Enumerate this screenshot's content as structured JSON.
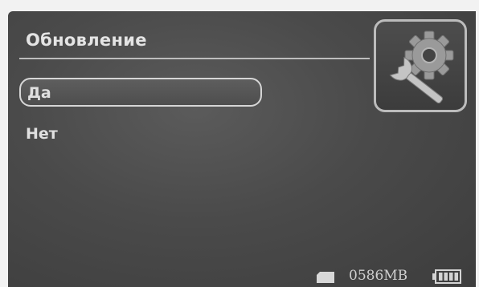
{
  "screen": {
    "title": "Обновление"
  },
  "menu": {
    "items": [
      {
        "label": "Да",
        "selected": true
      },
      {
        "label": "Нет",
        "selected": false
      }
    ]
  },
  "icons": {
    "settings": "gear-and-wrench-icon",
    "storage": "sd-card-icon",
    "battery": "battery-icon"
  },
  "status": {
    "storage": "0586MB",
    "battery_level": 1.0
  },
  "colors": {
    "background": "#4a4a4a",
    "text": "#e0e0e0",
    "accent": "#d6d6d6"
  }
}
